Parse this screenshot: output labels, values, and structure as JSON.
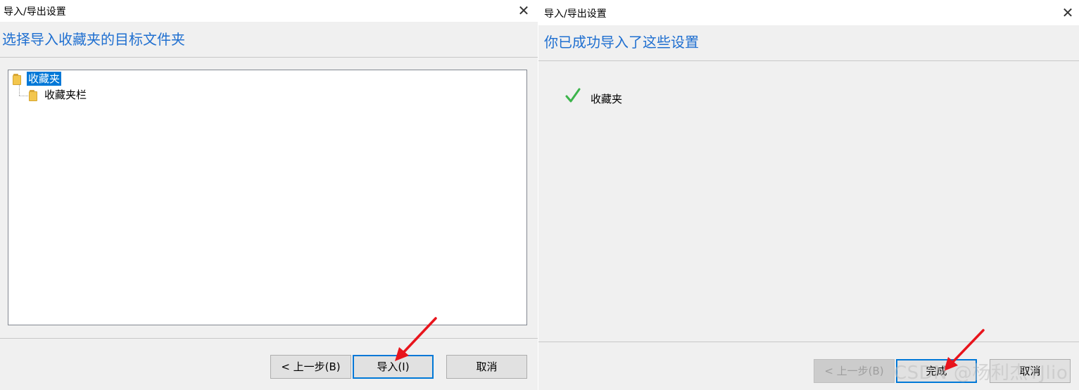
{
  "left_dialog": {
    "title": "导入/导出设置",
    "heading": "选择导入收藏夹的目标文件夹",
    "tree": {
      "root": "收藏夹",
      "child": "收藏夹栏"
    },
    "buttons": {
      "back": "< 上一步(B)",
      "import": "导入(I)",
      "cancel": "取消"
    }
  },
  "right_dialog": {
    "title": "导入/导出设置",
    "heading": "你已成功导入了这些设置",
    "result_item": "收藏夹",
    "buttons": {
      "back": "< 上一步(B)",
      "finish": "完成",
      "cancel": "取消"
    }
  },
  "watermark": "CSDN @杨利杰YJlio",
  "colors": {
    "heading": "#1f6fd0",
    "selection": "#0078d7",
    "annotation_arrow": "#e8141c",
    "check": "#3cb44b"
  }
}
